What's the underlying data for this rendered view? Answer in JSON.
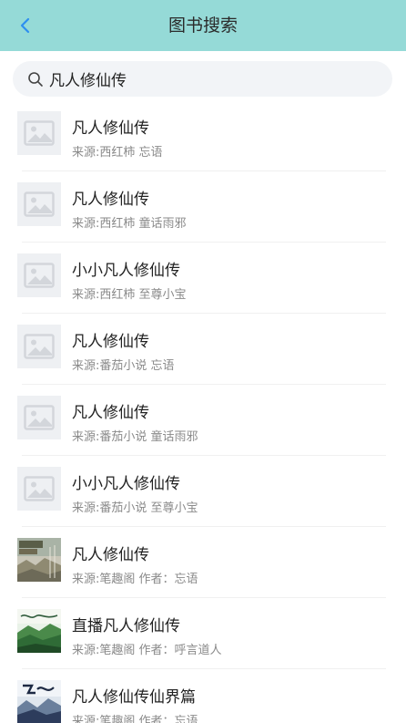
{
  "header": {
    "title": "图书搜索",
    "back_icon": "chevron-left-icon",
    "background": "#95dad7",
    "accent": "#2e8ff0"
  },
  "search": {
    "value": "凡人修仙传",
    "icon": "search-icon"
  },
  "results": [
    {
      "title": "凡人修仙传",
      "meta": "来源:西红柿 忘语",
      "cover": "placeholder"
    },
    {
      "title": "凡人修仙传",
      "meta": "来源:西红柿 童话雨邪",
      "cover": "placeholder"
    },
    {
      "title": "小小凡人修仙传",
      "meta": "来源:西红柿 至尊小宝",
      "cover": "placeholder"
    },
    {
      "title": "凡人修仙传",
      "meta": "来源:番茄小说 忘语",
      "cover": "placeholder"
    },
    {
      "title": "凡人修仙传",
      "meta": "来源:番茄小说 童话雨邪",
      "cover": "placeholder"
    },
    {
      "title": "小小凡人修仙传",
      "meta": "来源:番茄小说 至尊小宝",
      "cover": "placeholder"
    },
    {
      "title": "凡人修仙传",
      "meta": "来源:笔趣阁 作者：忘语",
      "cover": "book-cover-1"
    },
    {
      "title": "直播凡人修仙传",
      "meta": "来源:笔趣阁 作者：呼言道人",
      "cover": "book-cover-2"
    },
    {
      "title": "凡人修仙传仙界篇",
      "meta": "来源:笔趣阁 作者：忘语",
      "cover": "book-cover-3"
    }
  ]
}
